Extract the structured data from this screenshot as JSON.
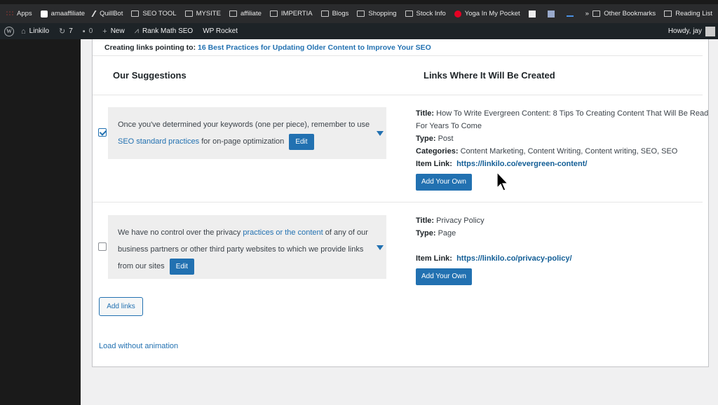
{
  "bookmarks": {
    "items": [
      "Apps",
      "amaaffiliate",
      "QuillBot",
      "SEO TOOL",
      "MYSITE",
      "affiliate",
      "IMPERTIA",
      "Blogs",
      "Shopping",
      "Stock Info",
      "Yoga In My Pocket"
    ],
    "overflow": "»",
    "other": "Other Bookmarks",
    "reading_list": "Reading List"
  },
  "admin_bar": {
    "site": "Linkilo",
    "updates": "7",
    "comments": "0",
    "new": "New",
    "rank_math": "Rank Math SEO",
    "wp_rocket": "WP Rocket",
    "howdy": "Howdy, jay"
  },
  "page": {
    "creating_label": "Creating links pointing to:",
    "target_title": "16 Best Practices for Updating Older Content to Improve Your SEO",
    "col_suggestions": "Our Suggestions",
    "col_links": "Links Where It Will Be Created",
    "add_links": "Add links",
    "load_without_animation": "Load without animation"
  },
  "rows": [
    {
      "checked": true,
      "text_before": "Once you've determined your keywords (one per piece), remember to use ",
      "anchor": "SEO standard practices",
      "text_after": " for on-page optimization",
      "edit": "Edit",
      "title_label": "Title:",
      "title": "How To Write Evergreen Content: 8 Tips To Creating Content That Will Be Read For Years To Come",
      "type_label": "Type:",
      "type": "Post",
      "categories_label": "Categories:",
      "categories": "Content Marketing, Content Writing, Content writing, SEO, SEO",
      "link_label": "Item Link:",
      "link": "https://linkilo.co/evergreen-content/",
      "add_own": "Add Your Own"
    },
    {
      "checked": false,
      "text_before": "We have no control over the privacy ",
      "anchor": "practices or the content",
      "text_after": " of any of our business partners or other third party websites to which we provide links from our sites",
      "edit": "Edit",
      "title_label": "Title:",
      "title": "Privacy Policy",
      "type_label": "Type:",
      "type": "Page",
      "link_label": "Item Link:",
      "link": "https://linkilo.co/privacy-policy/",
      "add_own": "Add Your Own"
    }
  ]
}
